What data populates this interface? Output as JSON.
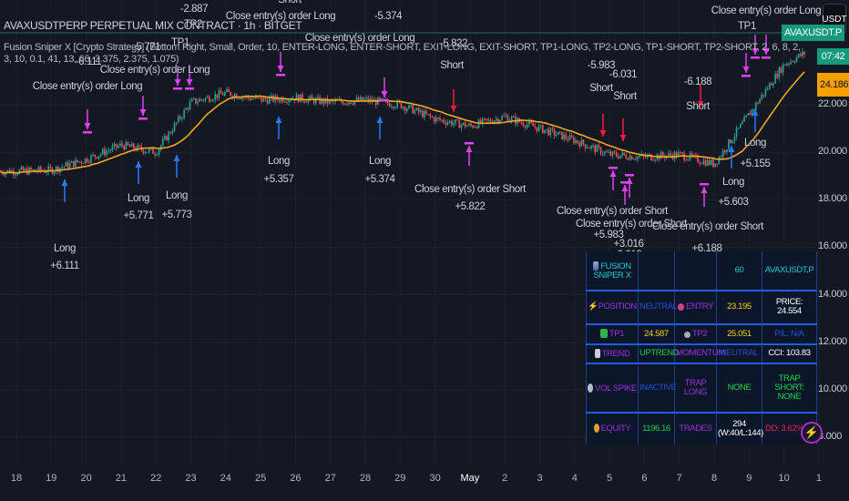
{
  "header": {
    "symbol_line": "AVAXUSDTPERP PERPETUAL MIX CONTRACT · 1h · BITGET",
    "strategy_line": "Fusion Sniper X [Crypto Strategy] (Bottom Right, Small, Order, 10, ENTER-LONG, ENTER-SHORT, EXIT-LONG, EXIT-SHORT, TP1-LONG, TP2-LONG, TP1-SHORT, TP2-SHORT, 2, 6, 8, 2, 3, 10, 0.1, 41, 13, 66, 2.375, 2.375, 1.075)"
  },
  "currency_button": "USDT",
  "price_tags": {
    "symbol": "AVAXUSDT.P",
    "countdown": "07:42",
    "last_price": "24.186"
  },
  "colors": {
    "background": "#141823",
    "up": "#26a69a",
    "down": "#ef5350",
    "ma": "#f5a623",
    "long_arrow": "#2979ff",
    "short_arrow": "#ff1744",
    "close_arrow": "#e040fb",
    "price_tag_green": "#159a7c",
    "price_tag_orange": "#f59f00"
  },
  "chart_data": {
    "type": "candlestick",
    "timeframe": "1h",
    "y_ticks": [
      "22.000",
      "20.000",
      "18.000",
      "16.000",
      "14.000",
      "12.000",
      "10.000",
      "8.000"
    ],
    "x_ticks": [
      "18",
      "19",
      "20",
      "21",
      "22",
      "23",
      "24",
      "25",
      "26",
      "27",
      "28",
      "29",
      "30",
      "May",
      "2",
      "3",
      "4",
      "5",
      "6",
      "7",
      "8",
      "9",
      "10",
      "1"
    ],
    "ylim": [
      7.5,
      26.4
    ],
    "approx_close": [
      [
        "Apr 17",
        19.2
      ],
      [
        "Apr 18",
        19.2
      ],
      [
        "Apr 19",
        19.25
      ],
      [
        "Apr 20",
        19.7
      ],
      [
        "Apr 21",
        20.3
      ],
      [
        "Apr 22",
        20.0
      ],
      [
        "Apr 23",
        22.1
      ],
      [
        "Apr 24",
        22.5
      ],
      [
        "Apr 25",
        22.2
      ],
      [
        "Apr 26",
        22.3
      ],
      [
        "Apr 27",
        22.1
      ],
      [
        "Apr 28",
        22.2
      ],
      [
        "Apr 29",
        22.0
      ],
      [
        "Apr 30",
        21.4
      ],
      [
        "May 1",
        21.1
      ],
      [
        "May 2",
        21.5
      ],
      [
        "May 3",
        21.0
      ],
      [
        "May 4",
        20.5
      ],
      [
        "May 5",
        19.9
      ],
      [
        "May 6",
        19.8
      ],
      [
        "May 7",
        19.9
      ],
      [
        "May 8",
        19.5
      ],
      [
        "May 9",
        21.6
      ],
      [
        "May 10",
        23.7
      ],
      [
        "May 11",
        24.5
      ]
    ]
  },
  "annotations": [
    "Short",
    "Close entry(s) order Long",
    "-5.374",
    "Close entry(s) order Long",
    "-2.887",
    "TP2",
    "-5.771",
    "-6.111",
    "Close entry(s) order Long",
    "Close entry(s) order Long",
    "Long",
    "+6.111",
    "Long",
    "+5.771",
    "Long",
    "+5.773",
    "Long",
    "+5.357",
    "Long",
    "+5.374",
    "-5.822",
    "Short",
    "Close entry(s) order Short",
    "+5.822",
    "-5.983",
    "Short",
    "-6.031",
    "Short",
    "-6.188",
    "Short",
    "Close entry(s) order Short",
    "Close entry(s) order Short",
    "+5.983",
    "+3.016",
    "+3.013",
    "Close entry(s) order Short",
    "+6.188",
    "Long",
    "+5.603",
    "Long",
    "+5.155",
    "Close entry(s) order Long",
    "TP1",
    "TP1"
  ],
  "table": {
    "rows": [
      [
        "FUSION SNIPER X",
        "",
        "",
        "60",
        "AVAXUSDT.P"
      ],
      [
        "POSITION",
        "NEUTRAL",
        "ENTRY",
        "23.195",
        "PRICE: 24.554"
      ],
      [
        "TP1",
        "24.587",
        "TP2",
        "25.051",
        "P/L: N/A"
      ],
      [
        "TREND",
        "UPTREND",
        "MOMENTUM",
        "NEUTRAL",
        "CCI: 103.83"
      ],
      [
        "VOL SPIKE",
        "INACTIVE",
        "TRAP LONG",
        "NONE",
        "TRAP SHORT: NONE"
      ],
      [
        "EQUITY",
        "1196.16",
        "TRADES",
        "294 (W:40/L:144)",
        "DD: 3.62%"
      ]
    ]
  }
}
